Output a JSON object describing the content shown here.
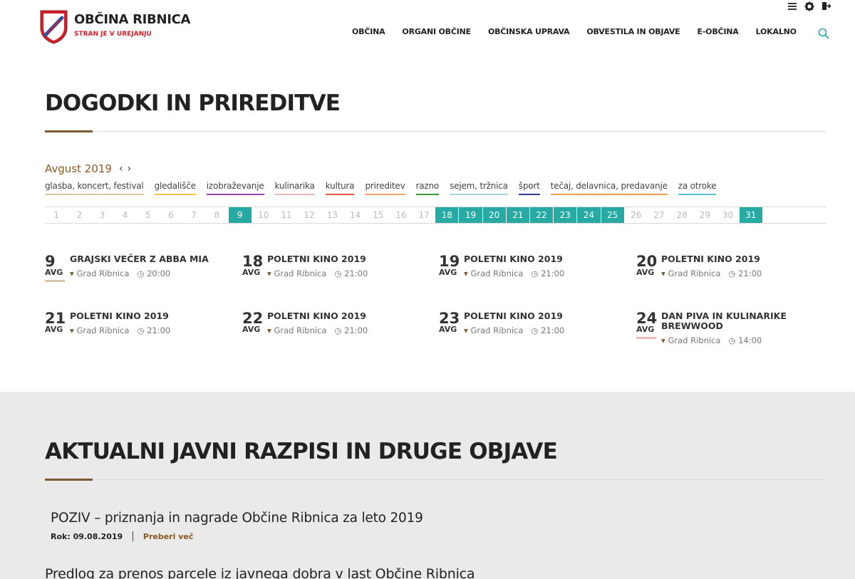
{
  "header": {
    "title": "OBČINA RIBNICA",
    "subtitle": "STRAN JE V UREJANJU",
    "nav": [
      "OBČINA",
      "ORGANI OBČINE",
      "OBČINSKA UPRAVA",
      "OBVESTILA IN OBJAVE",
      "E-OBČINA",
      "LOKALNO"
    ],
    "top_icons": [
      "menu-icon",
      "gear-icon",
      "logout-icon"
    ],
    "brand_red": "#d0202a",
    "accent_teal": "#27a9a4"
  },
  "events_section": {
    "title": "DOGODKI IN PRIREDITVE",
    "month": "Avgust 2019",
    "categories": [
      {
        "label": "glasba, koncert, festival",
        "color": "#d9c6a6"
      },
      {
        "label": "gledališče",
        "color": "#f2c34b"
      },
      {
        "label": "izobraževanje",
        "color": "#9b3fb5"
      },
      {
        "label": "kulinarika",
        "color": "#f0b9b9"
      },
      {
        "label": "kultura",
        "color": "#e0553b"
      },
      {
        "label": "prireditev",
        "color": "#f3a56a"
      },
      {
        "label": "razno",
        "color": "#3a9a3a"
      },
      {
        "label": "sejem, tržnica",
        "color": "#a8d4ea"
      },
      {
        "label": "šport",
        "color": "#2b3f8c"
      },
      {
        "label": "tečaj, delavnica, predavanje",
        "color": "#f0a04b"
      },
      {
        "label": "za otroke",
        "color": "#5bc2d4"
      }
    ],
    "days": [
      "1",
      "2",
      "3",
      "4",
      "5",
      "6",
      "7",
      "8",
      "9",
      "10",
      "11",
      "12",
      "13",
      "14",
      "15",
      "16",
      "17",
      "18",
      "19",
      "20",
      "21",
      "22",
      "23",
      "24",
      "25",
      "26",
      "27",
      "28",
      "29",
      "30",
      "31"
    ],
    "active_days": [
      "9",
      "18",
      "19",
      "20",
      "21",
      "22",
      "23",
      "24",
      "25",
      "31"
    ],
    "events": [
      {
        "day": "9",
        "month": "AVG",
        "title": "GRAJSKI VEČER Z ABBA MIA",
        "place": "Grad Ribnica",
        "time": "20:00",
        "bar": "#d9c6a6"
      },
      {
        "day": "18",
        "month": "AVG",
        "title": "POLETNI KINO 2019",
        "place": "Grad Ribnica",
        "time": "21:00",
        "bar": ""
      },
      {
        "day": "19",
        "month": "AVG",
        "title": "POLETNI KINO 2019",
        "place": "Grad Ribnica",
        "time": "21:00",
        "bar": ""
      },
      {
        "day": "20",
        "month": "AVG",
        "title": "POLETNI KINO 2019",
        "place": "Grad Ribnica",
        "time": "21:00",
        "bar": ""
      },
      {
        "day": "21",
        "month": "AVG",
        "title": "POLETNI KINO 2019",
        "place": "Grad Ribnica",
        "time": "21:00",
        "bar": ""
      },
      {
        "day": "22",
        "month": "AVG",
        "title": "POLETNI KINO 2019",
        "place": "Grad Ribnica",
        "time": "21:00",
        "bar": ""
      },
      {
        "day": "23",
        "month": "AVG",
        "title": "POLETNI KINO 2019",
        "place": "Grad Ribnica",
        "time": "21:00",
        "bar": ""
      },
      {
        "day": "24",
        "month": "AVG",
        "title": "DAN PIVA IN KULINARIKE BREWWOOD",
        "place": "Grad Ribnica",
        "time": "14:00",
        "bar": "#f0b9b9"
      }
    ]
  },
  "notices_section": {
    "title": "AKTUALNI JAVNI RAZPISI IN DRUGE OBJAVE",
    "posts": [
      {
        "title": "POZIV – priznanja in nagrade Občine Ribnica za leto 2019",
        "deadline": "Rok: 09.08.2019",
        "more": "Preberi več"
      },
      {
        "title": "Predlog za prenos parcele iz javnega dobra v last Občine Ribnica"
      }
    ]
  }
}
